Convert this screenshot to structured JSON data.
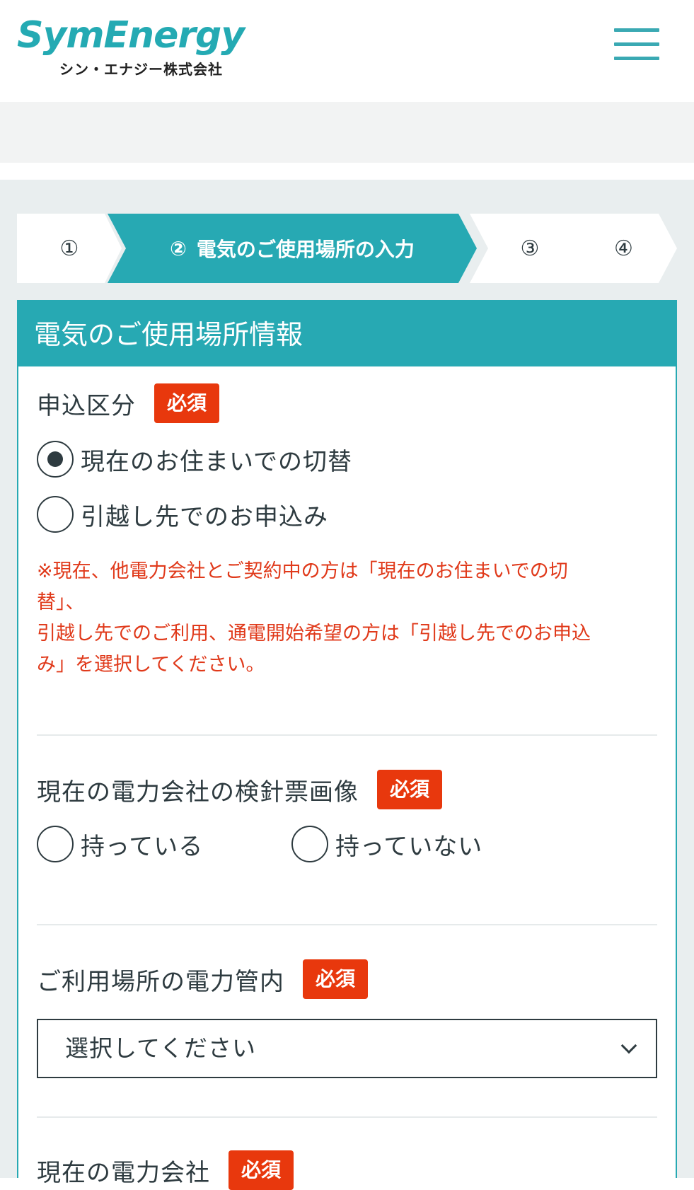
{
  "header": {
    "logo_main": "SymEnergy",
    "logo_sub": "シン・エナジー株式会社",
    "menu_icon": "hamburger-menu-icon"
  },
  "stepper": {
    "steps": [
      {
        "num": "①",
        "label": ""
      },
      {
        "num": "②",
        "label": "電気のご使用場所の入力"
      },
      {
        "num": "③",
        "label": ""
      },
      {
        "num": "④",
        "label": ""
      }
    ],
    "active_step": 2
  },
  "card": {
    "title": "電気のご使用場所情報",
    "required_label": "必須",
    "application_type": {
      "label": "申込区分",
      "options": [
        "現在のお住まいでの切替",
        "引越し先でのお申込み"
      ],
      "selected": 0,
      "note_lines": [
        "※現在、他電力会社とご契約中の方は「現在のお住まいでの切",
        "替」、",
        "引越し先でのご利用、通電開始希望の方は「引越し先でのお申込",
        "み」を選択してください。"
      ]
    },
    "meter_image": {
      "label": "現在の電力会社の検針票画像",
      "options": [
        "持っている",
        "持っていない"
      ]
    },
    "power_area": {
      "label": "ご利用場所の電力管内",
      "select_placeholder": "選択してください"
    },
    "current_company": {
      "label": "現在の電力会社"
    }
  },
  "colors": {
    "brand": "#27a9b3",
    "required": "#e8380d",
    "note": "#e0391a"
  }
}
